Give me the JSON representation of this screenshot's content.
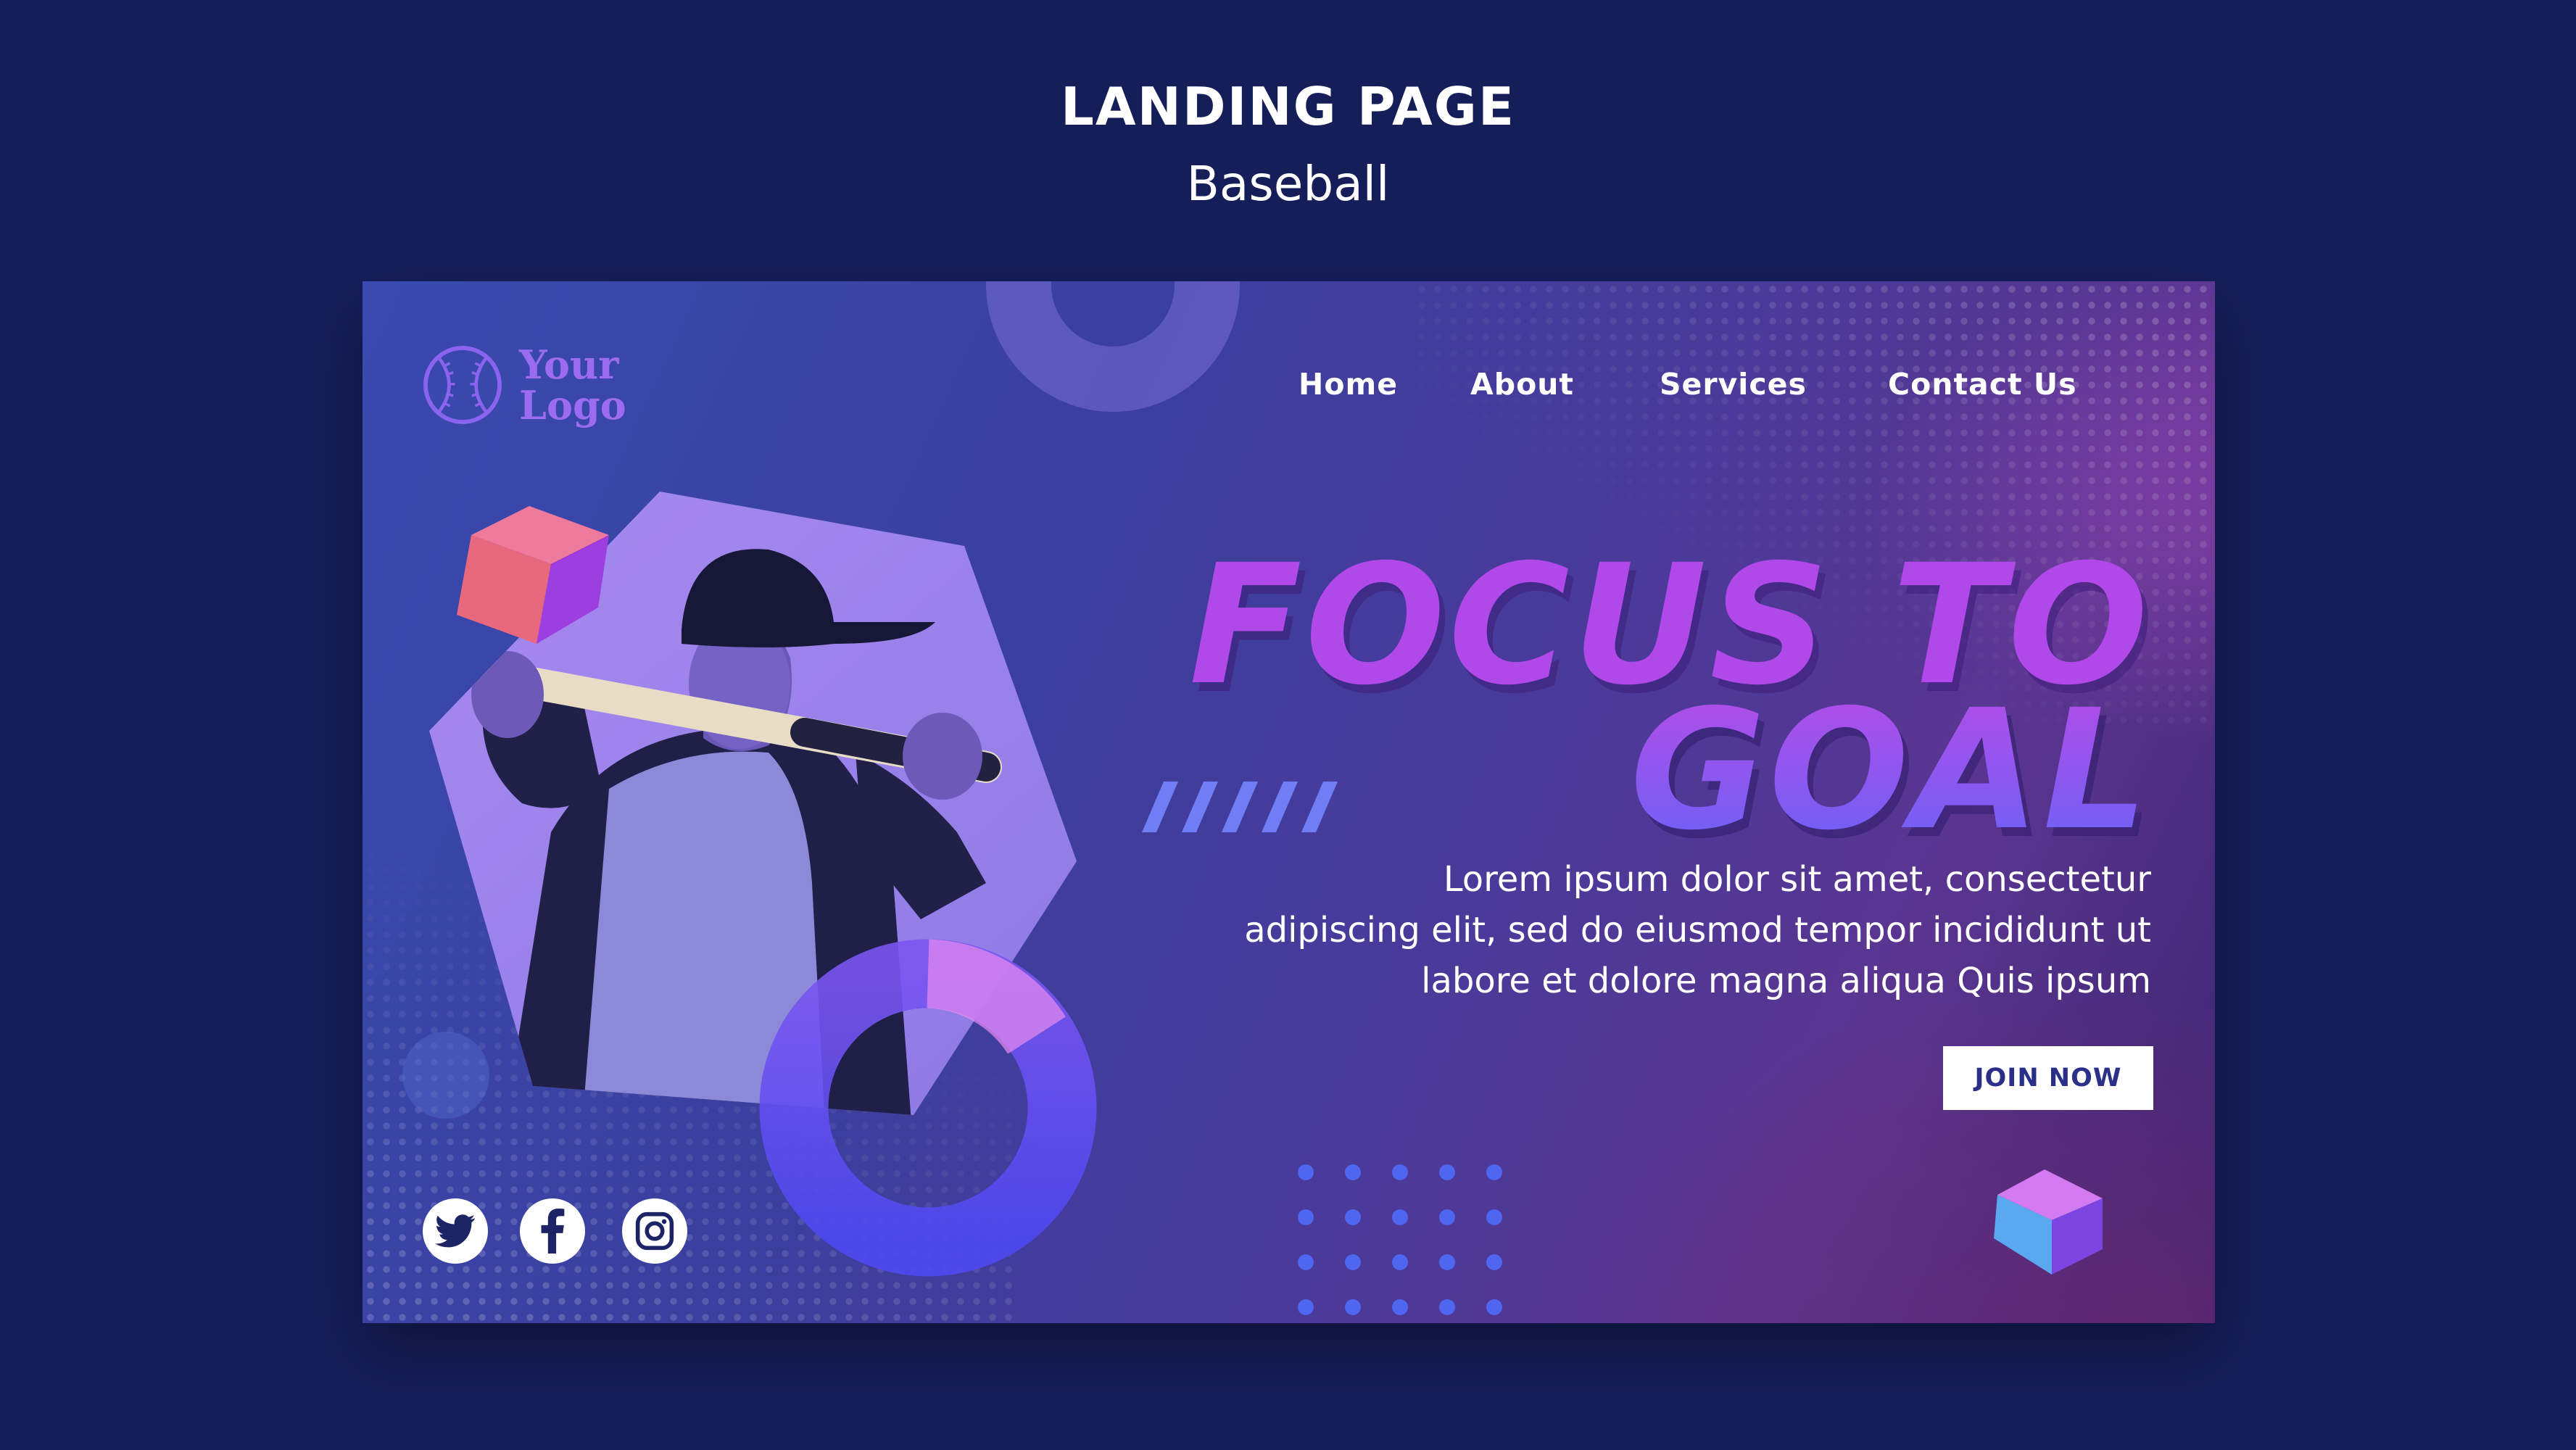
{
  "header": {
    "title": "LANDING PAGE",
    "subtitle": "Baseball"
  },
  "logo": {
    "line1": "Your",
    "line2": "Logo",
    "icon": "baseball-icon"
  },
  "nav": {
    "items": [
      "Home",
      "About",
      "Services",
      "Contact Us"
    ]
  },
  "hero": {
    "headline_line1": "FOCUS TO",
    "headline_line2": "GOAL",
    "body_lines": [
      "Lorem ipsum dolor sit amet, consectetur",
      "adipiscing elit, sed do eiusmod tempor incididunt ut",
      "labore et dolore magna aliqua Quis ipsum"
    ],
    "cta_label": "JOIN NOW"
  },
  "socials": {
    "icons": [
      "twitter-icon",
      "facebook-icon",
      "instagram-icon"
    ]
  },
  "colors": {
    "page_background": "#161e5a",
    "headline_purple": "#b048ea",
    "logo_purple": "#9b6cf0",
    "button_text": "#2a2f88",
    "dot_blue": "#4f66f0"
  }
}
